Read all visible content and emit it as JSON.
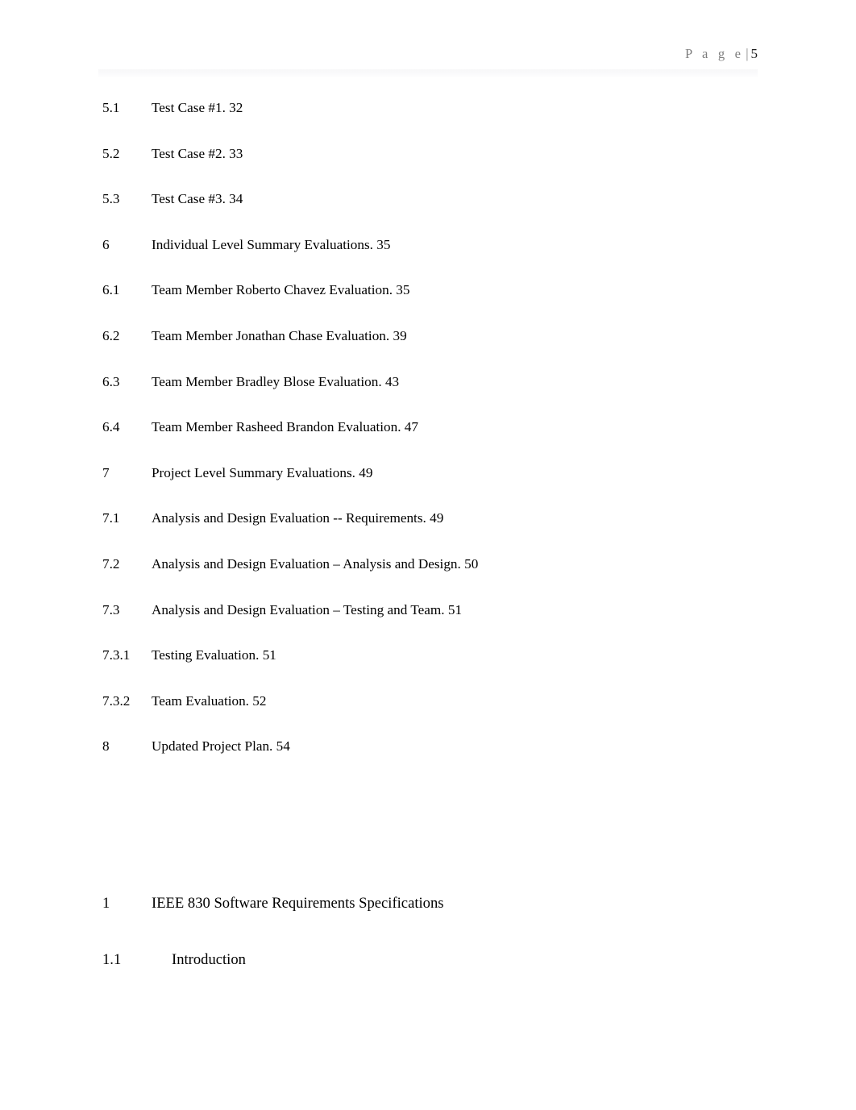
{
  "document": {
    "header": {
      "page_word": "P a g e",
      "separator": "|",
      "page_number": "5"
    },
    "colors": {
      "header_text": "#7f7f7f",
      "body_text": "#000000",
      "page_background": "#ffffff",
      "header_rule": "#f7f7f8"
    },
    "toc": {
      "entries": [
        {
          "number": "5.1",
          "title": "Test Case #1. 32"
        },
        {
          "number": "5.2",
          "title": "Test Case #2. 33"
        },
        {
          "number": "5.3",
          "title": "Test Case #3. 34"
        },
        {
          "number": "6",
          "title": "Individual Level Summary Evaluations. 35"
        },
        {
          "number": "6.1",
          "title": "Team Member Roberto Chavez Evaluation. 35"
        },
        {
          "number": "6.2",
          "title": "Team Member Jonathan Chase Evaluation. 39"
        },
        {
          "number": "6.3",
          "title": "Team Member Bradley Blose Evaluation. 43"
        },
        {
          "number": "6.4",
          "title": "Team Member Rasheed Brandon Evaluation. 47"
        },
        {
          "number": "7",
          "title": "Project Level Summary Evaluations. 49"
        },
        {
          "number": "7.1",
          "title": "Analysis and Design Evaluation -- Requirements. 49"
        },
        {
          "number": "7.2",
          "title": "Analysis and Design Evaluation – Analysis and Design. 50"
        },
        {
          "number": "7.3",
          "title": "Analysis and Design Evaluation – Testing and Team. 51"
        },
        {
          "number": "7.3.1",
          "title": "Testing Evaluation. 51"
        },
        {
          "number": "7.3.2",
          "title": "Team Evaluation. 52"
        },
        {
          "number": "8",
          "title": "Updated Project Plan. 54"
        }
      ]
    },
    "sections": [
      {
        "number": "1",
        "title": "IEEE 830 Software Requirements Specifications",
        "level": 1
      },
      {
        "number": "1.1",
        "title": "Introduction",
        "level": 2
      }
    ]
  }
}
